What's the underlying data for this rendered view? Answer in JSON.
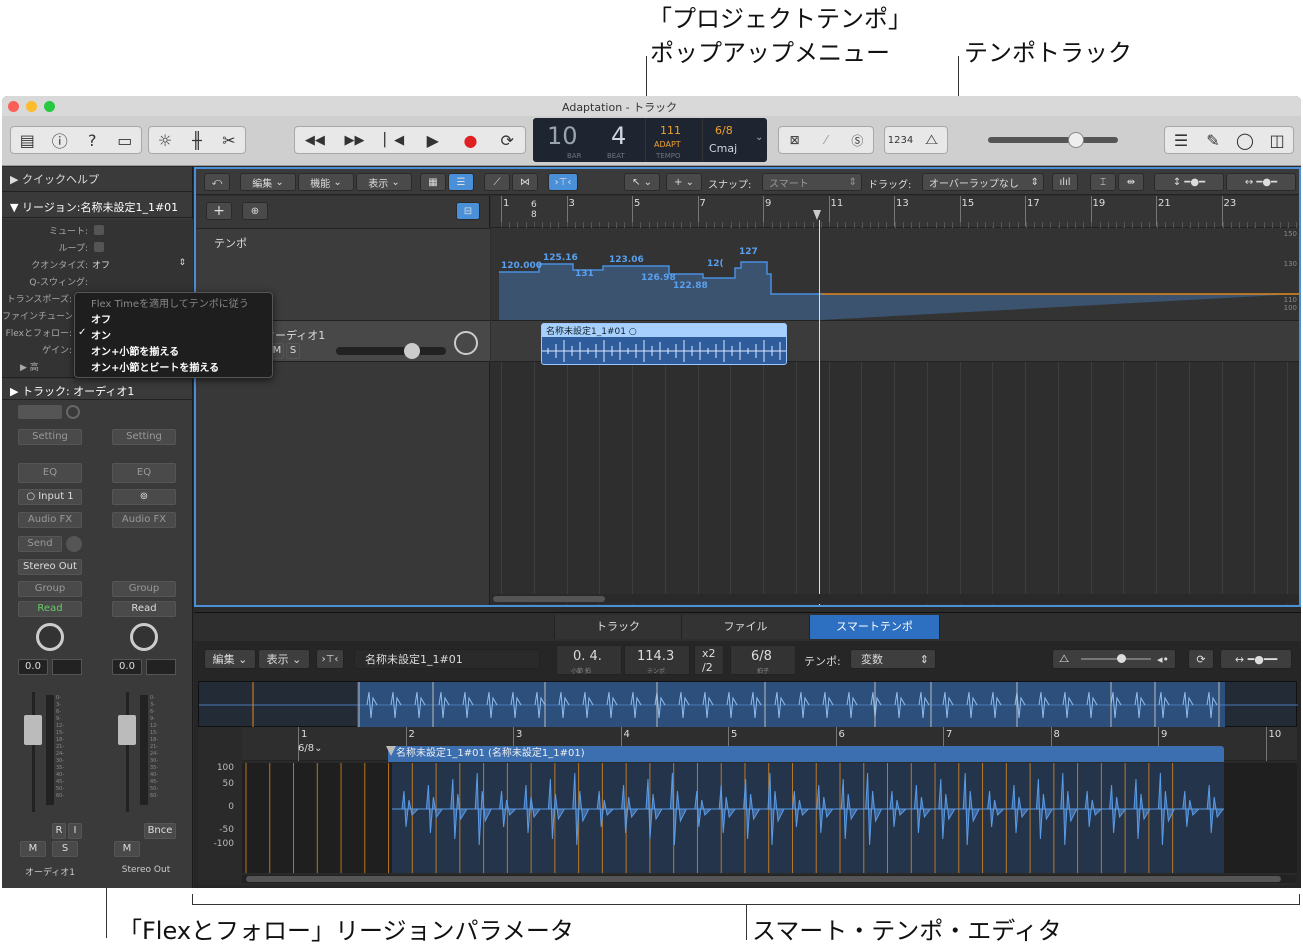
{
  "callouts": {
    "project_tempo_line1": "「プロジェクトテンポ」",
    "project_tempo_line2": "ポップアップメニュー",
    "tempo_track": "テンポトラック",
    "flex_follow": "「Flexとフォロー」リージョンパラメータ",
    "smart_tempo_editor": "スマート・テンポ・エディタ"
  },
  "window": {
    "title": "Adaptation - トラック"
  },
  "lcd": {
    "bar": "10",
    "beat": "4",
    "bar_label": "BAR",
    "beat_label": "BEAT",
    "tempo": "111",
    "tempo_mode": "ADAPT",
    "tempo_label": "TEMPO",
    "signature": "6/8",
    "key": "Cmaj"
  },
  "inspector": {
    "quick_help": "▶ クイックヘルプ",
    "region_header": "▼ リージョン:名称未設定1_1#01",
    "mute": "ミュート:",
    "loop": "ループ:",
    "quantize": "クオンタイズ:",
    "quantize_value": "オフ",
    "q_swing": "Q-スウィング:",
    "transpose": "トランスポーズ:",
    "fine_tune": "ファインチューン:",
    "flex_follow": "Flexとフォロー:",
    "gain": "ゲイン:",
    "more": "▶ 高",
    "track_header": "▶ トラック: オーディオ1",
    "ch1": {
      "setting": "Setting",
      "eq": "EQ",
      "input": "Input 1",
      "audio_fx": "Audio FX",
      "send": "Send",
      "output": "Stereo Out",
      "group": "Group",
      "automation": "Read",
      "volume": "0.0",
      "r": "R",
      "i": "I",
      "m": "M",
      "s": "S",
      "name": "オーディオ1"
    },
    "ch2": {
      "setting": "Setting",
      "eq": "EQ",
      "audio_fx": "Audio FX",
      "group": "Group",
      "automation": "Read",
      "volume": "0.0",
      "bounce": "Bnce",
      "m": "M",
      "name": "Stereo Out"
    },
    "meter_ticks": [
      "0-",
      "3-",
      "6-",
      "9-",
      "12-",
      "15-",
      "18-",
      "21-",
      "24-",
      "30-",
      "35-",
      "40-",
      "45-",
      "50-",
      "60-"
    ]
  },
  "flex_menu": {
    "header": "Flex Timeを適用してテンポに従う",
    "items": [
      "オフ",
      "オン",
      "オン+小節を揃える",
      "オン+小節とビートを揃える"
    ],
    "checked": "オン"
  },
  "main_toolbar": {
    "edit": "編集",
    "functions": "機能",
    "view": "表示",
    "snap_label": "スナップ:",
    "snap_value": "スマート",
    "drag_label": "ドラッグ:",
    "drag_value": "オーバーラップなし"
  },
  "tracks": {
    "tempo_label": "テンポ",
    "tempo_scale": [
      "150",
      "130",
      "110",
      "100"
    ],
    "audio_name": "オーディオ1",
    "m": "M",
    "s": "S",
    "region_name": "名称未設定1_1#01"
  },
  "ruler": {
    "bars": [
      "1",
      "3",
      "5",
      "7",
      "9",
      "11",
      "13",
      "15",
      "17",
      "19",
      "21",
      "23"
    ],
    "signature": "6\n8"
  },
  "tempo_points": [
    "120.000",
    "125.16",
    "131",
    "123.06",
    "126.98",
    "122.88",
    "12(",
    "127"
  ],
  "smart_tempo": {
    "tabs": [
      "トラック",
      "ファイル",
      "スマートテンポ"
    ],
    "active_tab": "スマートテンポ",
    "edit": "編集",
    "view": "表示",
    "region_name": "名称未設定1_1#01",
    "position": "0. 4.",
    "position_label": "小節  拍",
    "tempo": "114.3",
    "tempo_label": "テンポ",
    "x2": "x2",
    "div2": "/2",
    "signature": "6/8",
    "signature_label": "拍子",
    "tempo_mode_label": "テンポ:",
    "tempo_mode": "変数",
    "bars": [
      "1",
      "2",
      "3",
      "4",
      "5",
      "6",
      "7",
      "8",
      "9",
      "10"
    ],
    "bar_sig": "6/8⌄",
    "region_label": "名称未設定1_1#01 (名称未設定1_1#01)",
    "scale": [
      "100",
      "50",
      "0",
      "-50",
      "-100"
    ]
  },
  "colors": {
    "accent": "#4a90d9",
    "tempo_line": "#4a8fe0",
    "orange": "#e08a20",
    "region": "#3c6fb0"
  }
}
